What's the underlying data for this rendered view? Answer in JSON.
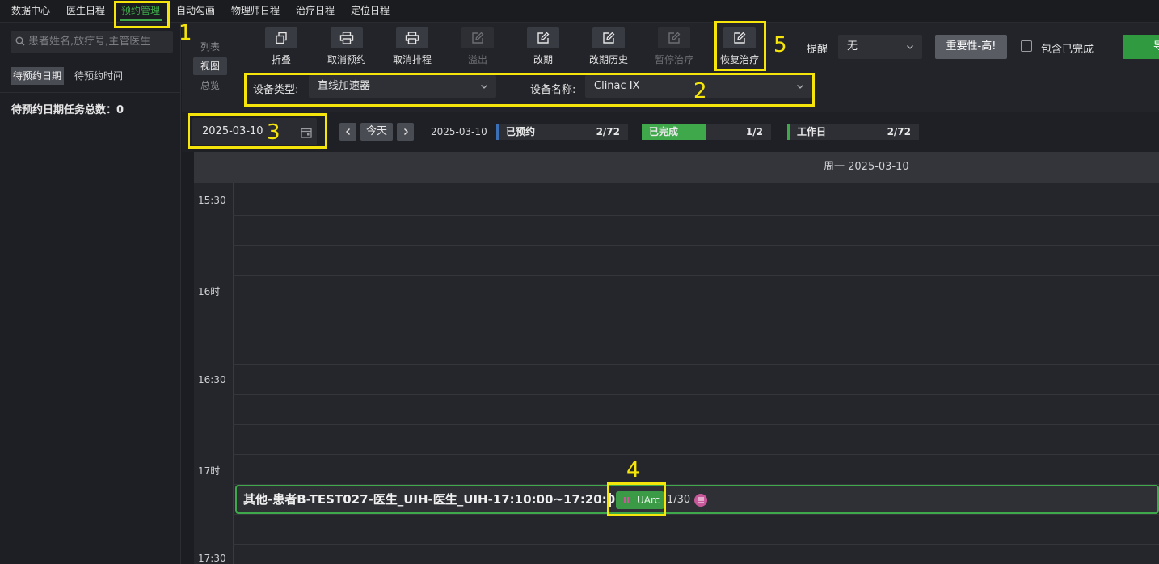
{
  "top_nav": {
    "items": [
      "数据中心",
      "医生日程",
      "预约管理",
      "自动勾画",
      "物理师日程",
      "治疗日程",
      "定位日程"
    ],
    "active": "预约管理"
  },
  "sidebar": {
    "search_placeholder": "患者姓名,放疗号,主管医生",
    "tabs": [
      "待预约日期",
      "待预约时间"
    ],
    "active_tab": "待预约日期",
    "count_label": "待预约日期任务总数：0"
  },
  "view_modes": {
    "items": [
      "列表",
      "视图",
      "总览"
    ],
    "active": "视图"
  },
  "toolbar": {
    "tools": [
      {
        "label": "折叠",
        "icon": "collapse-icon",
        "enabled": true
      },
      {
        "label": "取消预约",
        "icon": "printer-icon",
        "enabled": true
      },
      {
        "label": "取消排程",
        "icon": "printer-icon",
        "enabled": true
      },
      {
        "label": "溢出",
        "icon": "edit-icon",
        "enabled": false
      },
      {
        "label": "改期",
        "icon": "edit-icon",
        "enabled": true
      },
      {
        "label": "改期历史",
        "icon": "edit-icon",
        "enabled": true
      },
      {
        "label": "暂停治疗",
        "icon": "edit-icon",
        "enabled": false
      },
      {
        "label": "恢复治疗",
        "icon": "edit-icon",
        "enabled": true
      }
    ],
    "reminder_label": "提醒",
    "reminder_value": "无",
    "importance_button": "重要性-高!",
    "include_completed_label": "包含已完成",
    "export_button": "导"
  },
  "device_filter": {
    "type_label": "设备类型:",
    "type_value": "直线加速器",
    "name_label": "设备名称:",
    "name_value": "Clinac IX"
  },
  "date_bar": {
    "date_value": "2025-03-10",
    "today_button": "今天",
    "current_date": "2025-03-10",
    "stats": [
      {
        "label": "已预约",
        "value": "2/72",
        "color": "#3b6fb6"
      },
      {
        "label": "已完成",
        "value": "1/2",
        "color": "#3ea84a"
      },
      {
        "label": "工作日",
        "value": "2/72",
        "color": "#3ea84a"
      }
    ]
  },
  "calendar": {
    "day_header": "周一 2025-03-10",
    "time_labels": [
      "15:30",
      "16时",
      "16:30",
      "17时",
      "17:30"
    ],
    "event": {
      "title": "其他-患者B-TEST027-医生_UIH-医生_UIH-17:10:00~17:20:00",
      "technique": "UArc",
      "fraction": "1/30",
      "badge_icon": "list-icon"
    }
  },
  "annotations": [
    "1",
    "2",
    "3",
    "4",
    "5"
  ],
  "colors": {
    "accent_green": "#3ea84a",
    "highlight_yellow": "#f5e50a"
  }
}
